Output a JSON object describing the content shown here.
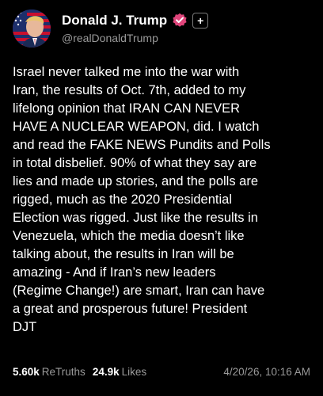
{
  "author": {
    "display_name": "Donald J. Trump",
    "handle": "@realDonaldTrump",
    "avatar_icon": "flag-portrait-avatar",
    "verified_icon": "verified-badge-icon",
    "follow_label": "+"
  },
  "post": {
    "text": "Israel never talked me into the war with\nIran, the results of Oct. 7th, added to my\nlifelong opinion that IRAN CAN NEVER\nHAVE A NUCLEAR WEAPON, did. I watch\nand read the FAKE NEWS Pundits and Polls\nin total disbelief. 90% of what they say are\nlies and made up stories, and the polls are\nrigged, much as the 2020 Presidential\nElection was rigged. Just like the results in\nVenezuela, which the media doesn’t like\ntalking about, the results in Iran will be\namazing - And if Iran’s new leaders\n(Regime Change!) are smart, Iran can have\na great and prosperous future! President\nDJT"
  },
  "stats": {
    "retruths_count": "5.60k",
    "retruths_label": "ReTruths",
    "likes_count": "24.9k",
    "likes_label": "Likes",
    "timestamp": "4/20/26, 10:16 AM"
  },
  "colors": {
    "background": "#000000",
    "text": "#ffffff",
    "muted": "#9a9a9a",
    "verified_badge": "#e0457b"
  }
}
